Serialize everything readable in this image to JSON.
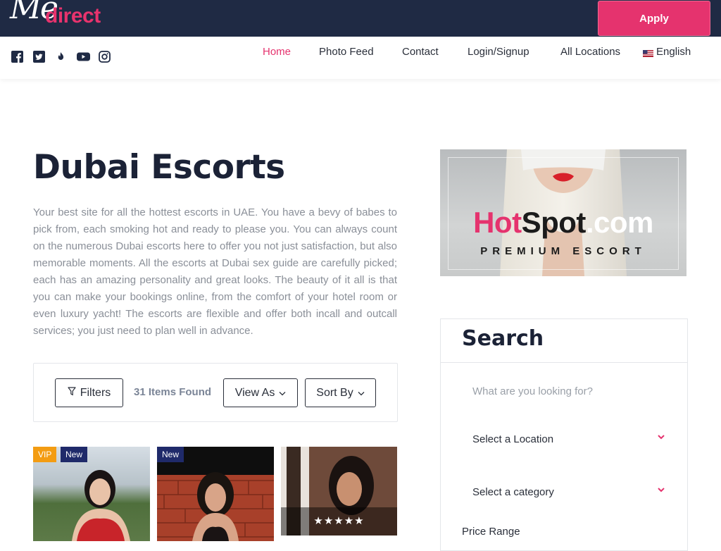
{
  "brand": {
    "logo_script": "Me",
    "logo_text": "direct",
    "accent": "#e5336e",
    "dark": "#1f2a44"
  },
  "header": {
    "apply_label": "Apply"
  },
  "social_icons": [
    "facebook-icon",
    "twitter-icon",
    "tinder-icon",
    "youtube-icon",
    "instagram-icon"
  ],
  "nav": {
    "home": "Home",
    "photo_feed": "Photo Feed",
    "contact": "Contact",
    "login": "Login/Signup",
    "all_locations": "All Locations",
    "language": "English"
  },
  "page": {
    "title": "Dubai Escorts",
    "description": "Your best site for all the hottest escorts in UAE. You have a bevy of babes to pick from, each smoking hot and ready to please you. You can always count on the numerous Dubai escorts here to offer you not just satisfaction, but also memorable moments. All the escorts at Dubai sex guide are carefully picked; each has an amazing personality and great looks. The beauty of it all is that you can make your bookings online, from the comfort of your hotel room or even luxury yacht! The escorts are flexible and offer both incall and outcall services; you just need to plan well in advance."
  },
  "toolbar": {
    "filters_label": "Filters",
    "items_found": "31 Items Found",
    "view_as_label": "View As",
    "sort_by_label": "Sort By"
  },
  "listings": [
    {
      "badges": [
        "VIP",
        "New"
      ],
      "rating": ""
    },
    {
      "badges": [
        "New"
      ],
      "rating": ""
    },
    {
      "badges": [],
      "rating": "★★★★★"
    }
  ],
  "badge_colors": {
    "VIP": "#f39c12",
    "New": "#1f2a6a"
  },
  "ad": {
    "hot": "Hot",
    "spot": "Spot",
    "com": ".com",
    "tagline": "PREMIUM ESCORT"
  },
  "search": {
    "title": "Search",
    "placeholder": "What are you looking for?",
    "location_label": "Select a Location",
    "category_label": "Select a category",
    "price_label": "Price Range"
  }
}
